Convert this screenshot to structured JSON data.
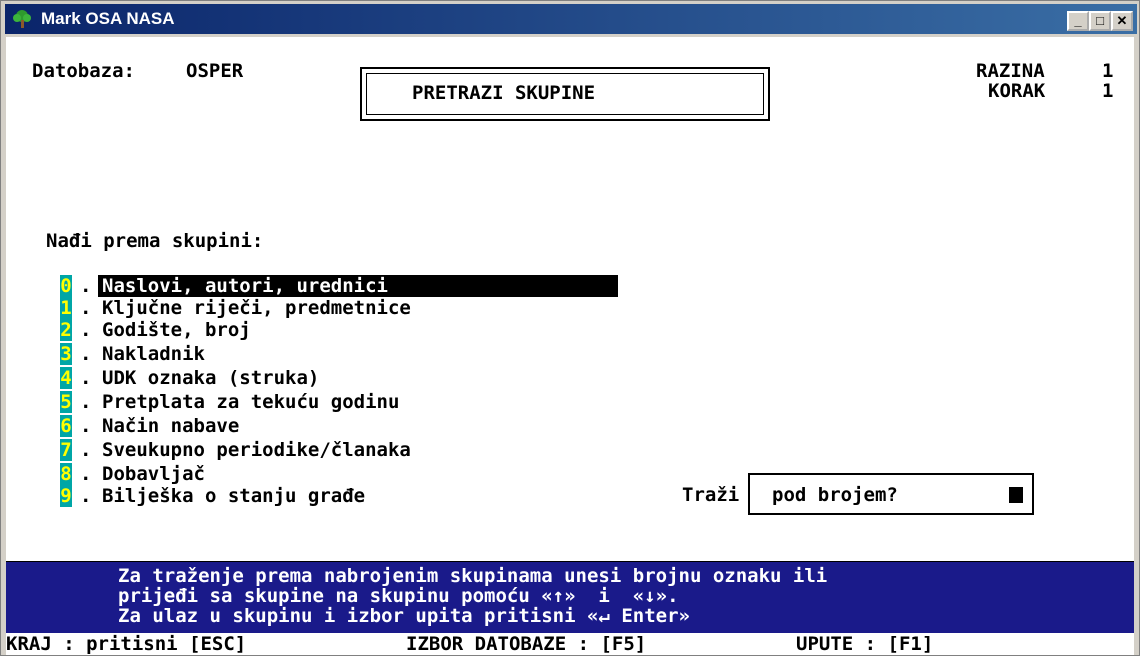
{
  "window": {
    "title": "Mark OSA NASA"
  },
  "header": {
    "database_label": "Datobaza:",
    "database_value": "OSPER",
    "screen_title": "PRETRAZI SKUPINE",
    "level_label": "RAZINA",
    "level_value": "1",
    "step_label": "KORAK",
    "step_value": "1"
  },
  "prompt": "Nađi prema skupini:",
  "menu": {
    "items": [
      {
        "num": "0",
        "label": "Naslovi, autori, urednici"
      },
      {
        "num": "1",
        "label": "Ključne riječi, predmetnice"
      },
      {
        "num": "2",
        "label": "Godište, broj"
      },
      {
        "num": "3",
        "label": "Nakladnik"
      },
      {
        "num": "4",
        "label": "UDK oznaka (struka)"
      },
      {
        "num": "5",
        "label": "Pretplata za tekuću godinu"
      },
      {
        "num": "6",
        "label": "Način nabave"
      },
      {
        "num": "7",
        "label": "Sveukupno periodike/članaka"
      },
      {
        "num": "8",
        "label": "Dobavljač"
      },
      {
        "num": "9",
        "label": "Bilješka o stanju građe"
      }
    ]
  },
  "search": {
    "label": "Traži",
    "value": "pod brojem?"
  },
  "help": {
    "line1": "Za traženje prema nabrojenim skupinama unesi brojnu oznaku ili",
    "line2": "prijeđi sa skupine na skupinu pomoću «↑»  i  «↓».",
    "line3": "Za ulaz u skupinu i izbor upita pritisni «↵ Enter»"
  },
  "footer": {
    "exit": "KRAJ : pritisni [ESC]",
    "db_select": "IZBOR DATOBAZE : [F5]",
    "help": "UPUTE : [F1]"
  }
}
